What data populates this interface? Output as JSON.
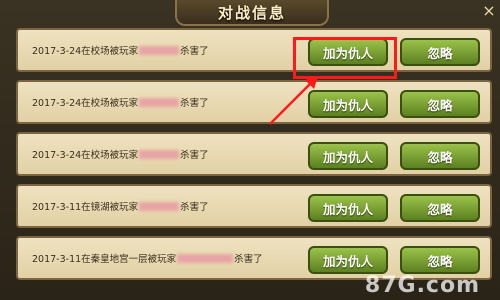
{
  "window": {
    "title": "对战信息",
    "close_glyph": "×"
  },
  "rows": [
    {
      "before": "2017-3-24在校场被玩家",
      "after": "杀害了",
      "action_enemy": "加为仇人",
      "action_ignore": "忽略"
    },
    {
      "before": "2017-3-24在校场被玩家",
      "after": "杀害了",
      "action_enemy": "加为仇人",
      "action_ignore": "忽略"
    },
    {
      "before": "2017-3-24在校场被玩家",
      "after": "杀害了",
      "action_enemy": "加为仇人",
      "action_ignore": "忽略"
    },
    {
      "before": "2017-3-11在镜湖被玩家",
      "after": "杀害了",
      "action_enemy": "加为仇人",
      "action_ignore": "忽略"
    },
    {
      "before": "2017-3-11在秦皇地宫一层被玩家",
      "after": "杀害了",
      "action_enemy": "加为仇人",
      "action_ignore": "忽略"
    }
  ],
  "watermark": "87G.com",
  "colors": {
    "highlight": "#ff1a1a",
    "button": "#7ea23a",
    "row_bg": "#e9dab4"
  }
}
